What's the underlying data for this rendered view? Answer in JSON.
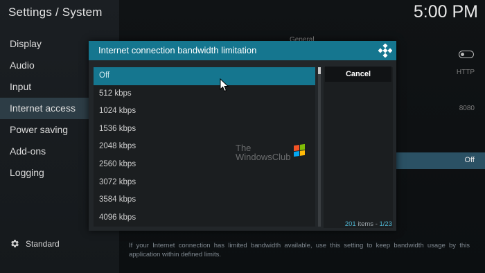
{
  "header": {
    "title": "Settings / System",
    "clock": "5:00 PM"
  },
  "sidebar": {
    "items": [
      {
        "label": "Display"
      },
      {
        "label": "Audio"
      },
      {
        "label": "Input"
      },
      {
        "label": "Internet access"
      },
      {
        "label": "Power saving"
      },
      {
        "label": "Add-ons"
      },
      {
        "label": "Logging"
      }
    ],
    "selected": "Internet access",
    "level_label": "Standard"
  },
  "background": {
    "section_label": "General",
    "proxy_type_value": "HTTP",
    "port_value": "8080",
    "bandwidth_value": "Off",
    "help_text": "If your Internet connection has limited bandwidth available, use this setting to keep bandwidth usage by this application within defined limits."
  },
  "dialog": {
    "title": "Internet connection bandwidth limitation",
    "options": [
      {
        "label": "Off"
      },
      {
        "label": "512 kbps"
      },
      {
        "label": "1024 kbps"
      },
      {
        "label": "1536 kbps"
      },
      {
        "label": "2048 kbps"
      },
      {
        "label": "2560 kbps"
      },
      {
        "label": "3072 kbps"
      },
      {
        "label": "3584 kbps"
      },
      {
        "label": "4096 kbps"
      }
    ],
    "selected_option": "Off",
    "cancel_label": "Cancel",
    "item_count": "201",
    "items_word": " items - ",
    "page": "1/23"
  },
  "watermark": {
    "line1": "The",
    "line2": "WindowsClub"
  },
  "colors": {
    "accent": "#15768f",
    "selected_sidebar": "#2d3d46",
    "background": "#15181b"
  },
  "icons": {
    "level": "gear-icon",
    "dialog": "kodi-logo-icon",
    "pointer": "mouse-cursor-icon"
  }
}
